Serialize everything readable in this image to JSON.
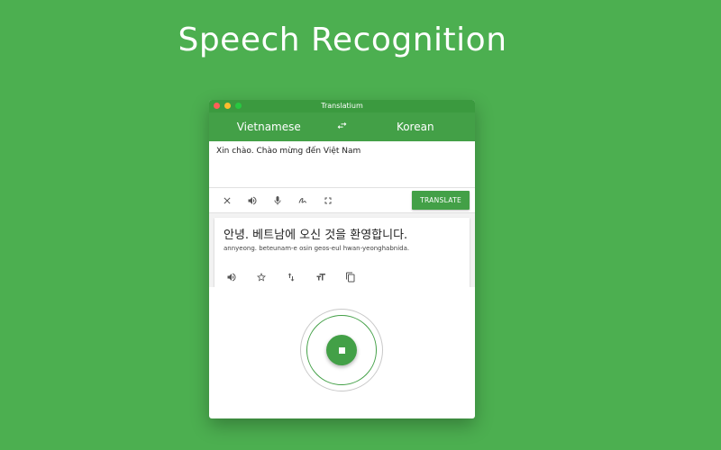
{
  "headline": "Speech Recognition",
  "window": {
    "title": "Translatium",
    "colors": {
      "close": "#ff5f57",
      "minimize": "#febc2e",
      "maximize": "#28c840",
      "accent": "#43a047"
    }
  },
  "languages": {
    "source": "Vietnamese",
    "target": "Korean",
    "swap_icon": "swap-arrows-icon"
  },
  "input": {
    "text": "Xin chào. Chào mừng đến Việt Nam"
  },
  "toolbar": {
    "icons": [
      "close-icon",
      "speaker-icon",
      "microphone-icon",
      "handwriting-icon",
      "fullscreen-icon"
    ],
    "translate_label": "TRANSLATE"
  },
  "output": {
    "text": "안녕. 베트남에 오신 것을 환영합니다.",
    "romanization": "annyeong. beteunam-e osin geos-eul hwan-yeonghabnida.",
    "icons": [
      "speaker-icon",
      "star-icon",
      "swap-vertical-icon",
      "text-size-icon",
      "copy-icon"
    ]
  },
  "recording": {
    "stop_icon": "stop-icon"
  }
}
